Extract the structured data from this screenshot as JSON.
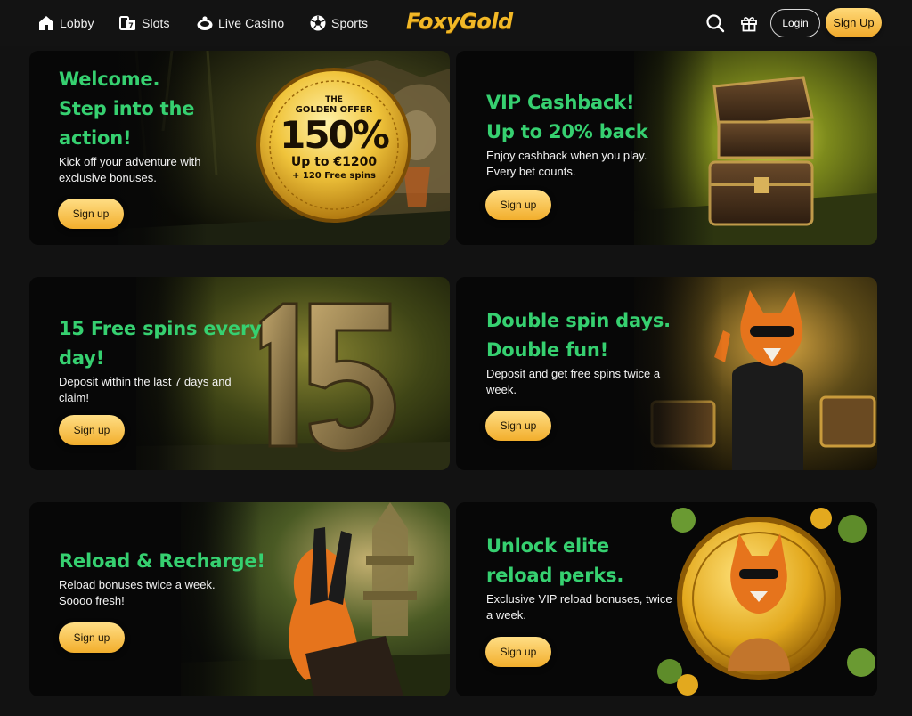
{
  "nav": {
    "items": [
      {
        "label": "Lobby",
        "icon": "home-icon"
      },
      {
        "label": "Slots",
        "icon": "slots-icon"
      },
      {
        "label": "Live Casino",
        "icon": "live-casino-icon"
      },
      {
        "label": "Sports",
        "icon": "soccer-ball-icon"
      }
    ]
  },
  "brand": {
    "name": "FoxyGold",
    "color": "#f2b827"
  },
  "header": {
    "login_label": "Login",
    "signup_label": "Sign Up",
    "icons": [
      "search-icon",
      "gift-icon"
    ]
  },
  "colors": {
    "headline": "#36d070",
    "cta_gold": "#f2ae2c",
    "background": "#121212"
  },
  "promos": [
    {
      "headline": [
        "Welcome.",
        "Step into the",
        "action!"
      ],
      "body": [
        "Kick off your adventure with",
        "exclusive bonuses."
      ],
      "cta": "Sign up",
      "badge": {
        "top": "THE",
        "sub": "GOLDEN OFFER",
        "big": "150%",
        "line": "Up to €1200",
        "extra": "+ 120 Free spins"
      }
    },
    {
      "headline": [
        "VIP Cashback!",
        "Up to 20% back"
      ],
      "body": [
        "Enjoy cashback when you play.",
        "Every bet counts."
      ],
      "cta": "Sign up"
    },
    {
      "headline": [
        "15 Free spins every",
        "day!"
      ],
      "body": [
        "Deposit within the last 7 days and",
        "claim!"
      ],
      "cta": "Sign up",
      "art_number": "15"
    },
    {
      "headline": [
        "Double spin days.",
        "Double fun!"
      ],
      "body": [
        "Deposit and get free spins twice a",
        "week."
      ],
      "cta": "Sign up"
    },
    {
      "headline": [
        "Reload & Recharge!"
      ],
      "body": [
        "Reload bonuses twice a week.",
        "Soooo fresh!"
      ],
      "cta": "Sign up"
    },
    {
      "headline": [
        "Unlock elite",
        "reload perks."
      ],
      "body": [
        "Exclusive VIP reload bonuses, twice",
        "a week."
      ],
      "cta": "Sign up"
    }
  ]
}
